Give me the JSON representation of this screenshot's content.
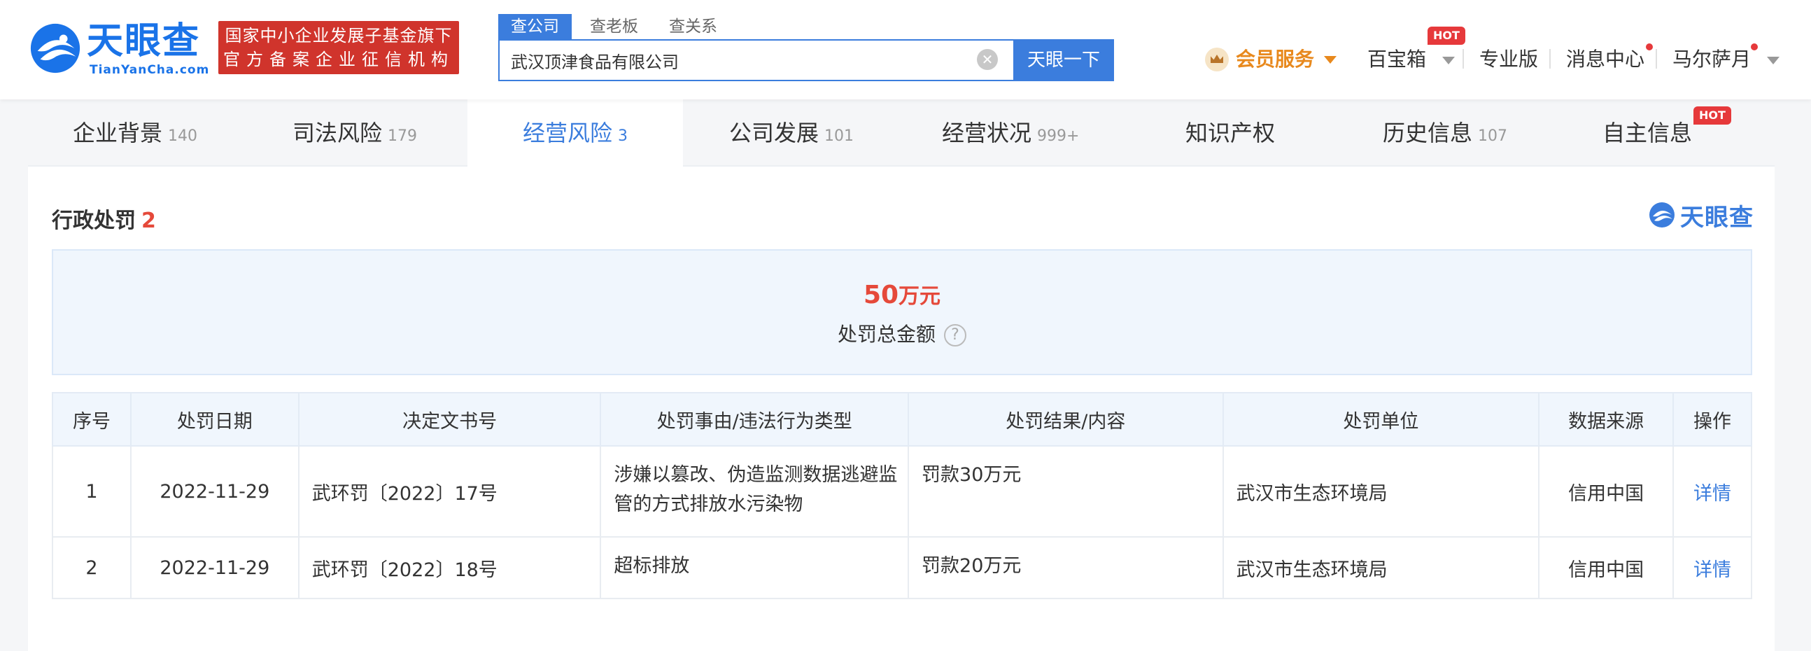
{
  "header": {
    "logo_text": "天眼查",
    "logo_sub": "TianYanCha.com",
    "fund_line1": "国家中小企业发展子基金旗下",
    "fund_line2": "官方备案企业征信机构",
    "search_tabs": [
      {
        "label": "查公司",
        "active": true
      },
      {
        "label": "查老板",
        "active": false
      },
      {
        "label": "查关系",
        "active": false
      }
    ],
    "search_value": "武汉顶津食品有限公司",
    "search_button": "天眼一下",
    "vip_label": "会员服务",
    "baobao_label": "百宝箱",
    "hot": "HOT",
    "pro_label": "专业版",
    "msg_label": "消息中心",
    "user_label": "马尔萨月"
  },
  "tabs": [
    {
      "label": "企业背景",
      "count": "140"
    },
    {
      "label": "司法风险",
      "count": "179"
    },
    {
      "label": "经营风险",
      "count": "3",
      "active": true
    },
    {
      "label": "公司发展",
      "count": "101"
    },
    {
      "label": "经营状况",
      "count": "999+"
    },
    {
      "label": "知识产权",
      "count": ""
    },
    {
      "label": "历史信息",
      "count": "107"
    },
    {
      "label": "自主信息",
      "count": "",
      "badge": "HOT"
    }
  ],
  "section": {
    "title": "行政处罚",
    "count": "2",
    "brand": "天眼查",
    "amount": "50",
    "amount_unit": "万元",
    "amount_label": "处罚总金额",
    "help": "?"
  },
  "table": {
    "headers": [
      "序号",
      "处罚日期",
      "决定文书号",
      "处罚事由/违法行为类型",
      "处罚结果/内容",
      "处罚单位",
      "数据来源",
      "操作"
    ],
    "rows": [
      {
        "no": "1",
        "date": "2022-11-29",
        "doc": "武环罚〔2022〕17号",
        "reason": "涉嫌以篡改、伪造监测数据逃避监管的方式排放水污染物",
        "result": "罚款30万元",
        "unit": "武汉市生态环境局",
        "source": "信用中国",
        "action": "详情"
      },
      {
        "no": "2",
        "date": "2022-11-29",
        "doc": "武环罚〔2022〕18号",
        "reason": "超标排放",
        "result": "罚款20万元",
        "unit": "武汉市生态环境局",
        "source": "信用中国",
        "action": "详情"
      }
    ]
  },
  "colors": {
    "brand_blue": "#3b7ddd",
    "accent_red": "#e5493a",
    "vip_orange": "#e8891d"
  }
}
